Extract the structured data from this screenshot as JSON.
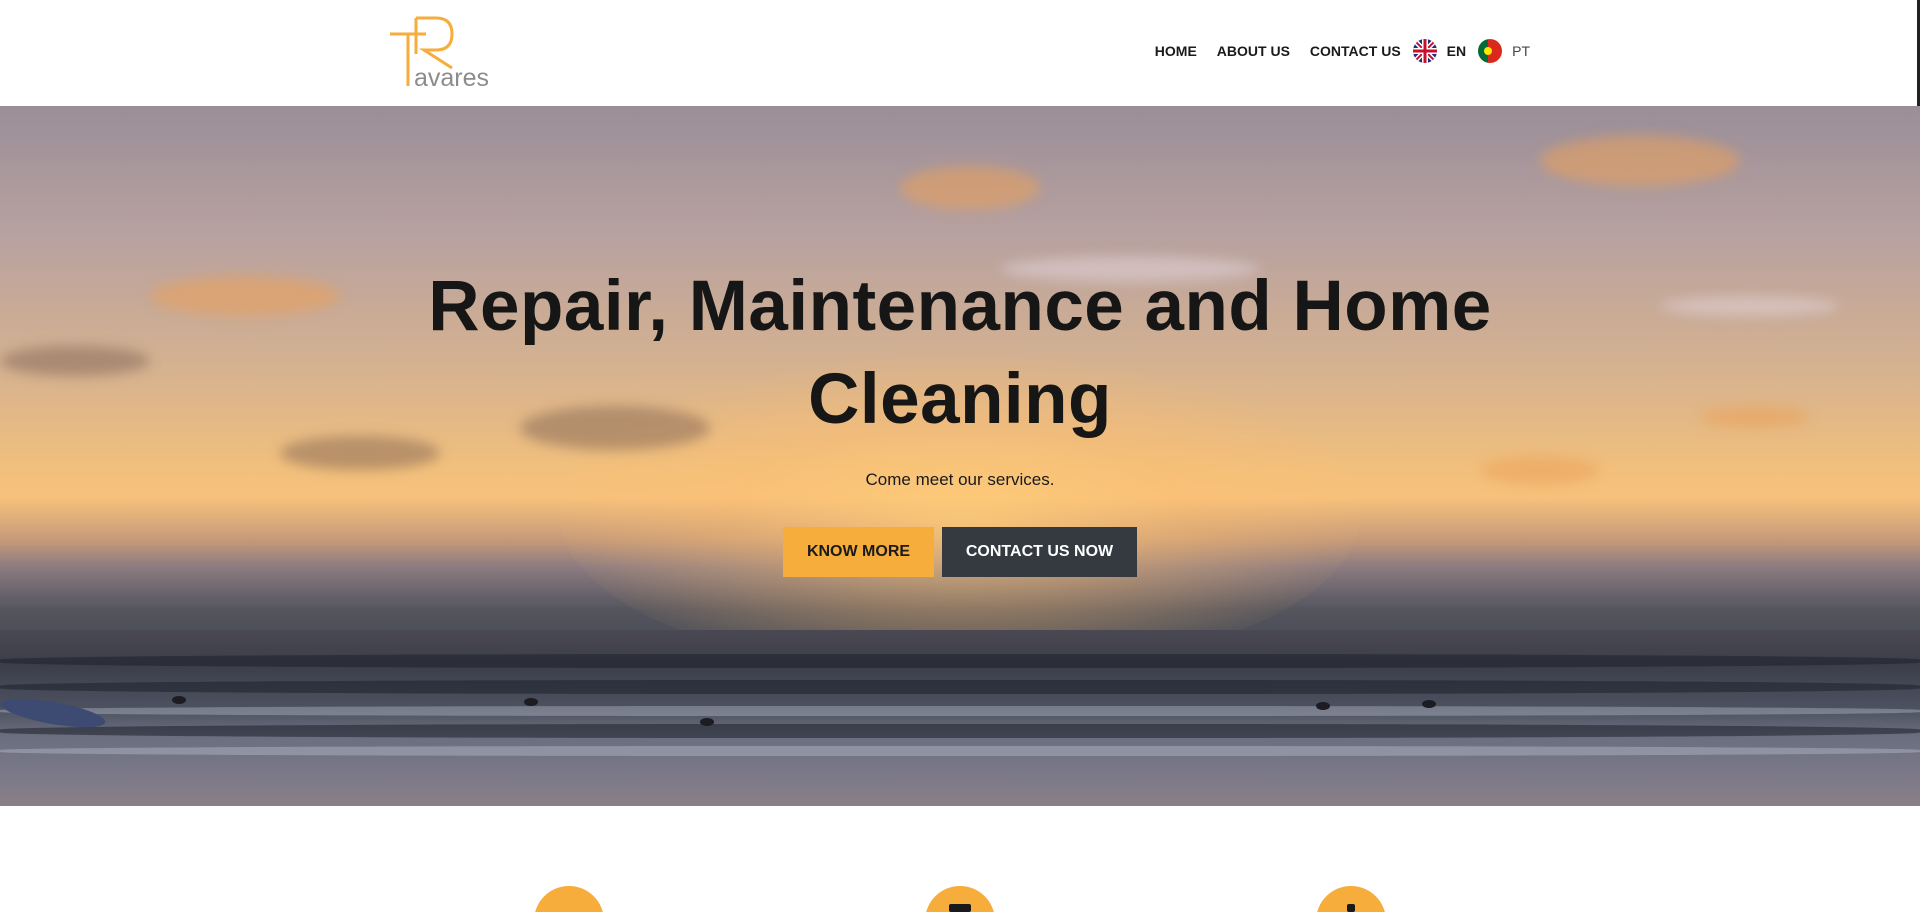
{
  "brand": {
    "logo_mark": "TR",
    "logo_text": "avares",
    "accent": "#f6ad3c"
  },
  "nav": {
    "items": [
      {
        "label": "HOME"
      },
      {
        "label": "ABOUT US"
      },
      {
        "label": "CONTACT US"
      }
    ],
    "languages": [
      {
        "label": "EN",
        "icon": "uk-flag-icon"
      },
      {
        "label": "PT",
        "icon": "portugal-flag-icon"
      }
    ]
  },
  "hero": {
    "title_line1": "Repair, Maintenance and Home",
    "title_line2": "Cleaning",
    "subtitle": "Come meet our services.",
    "primary_button": "KNOW MORE",
    "secondary_button": "CONTACT US NOW",
    "primary_color": "#f6ad3c",
    "secondary_color": "#343a40"
  },
  "features": {
    "icons": [
      "tools-icon",
      "cleaning-icon",
      "service-icon"
    ]
  }
}
